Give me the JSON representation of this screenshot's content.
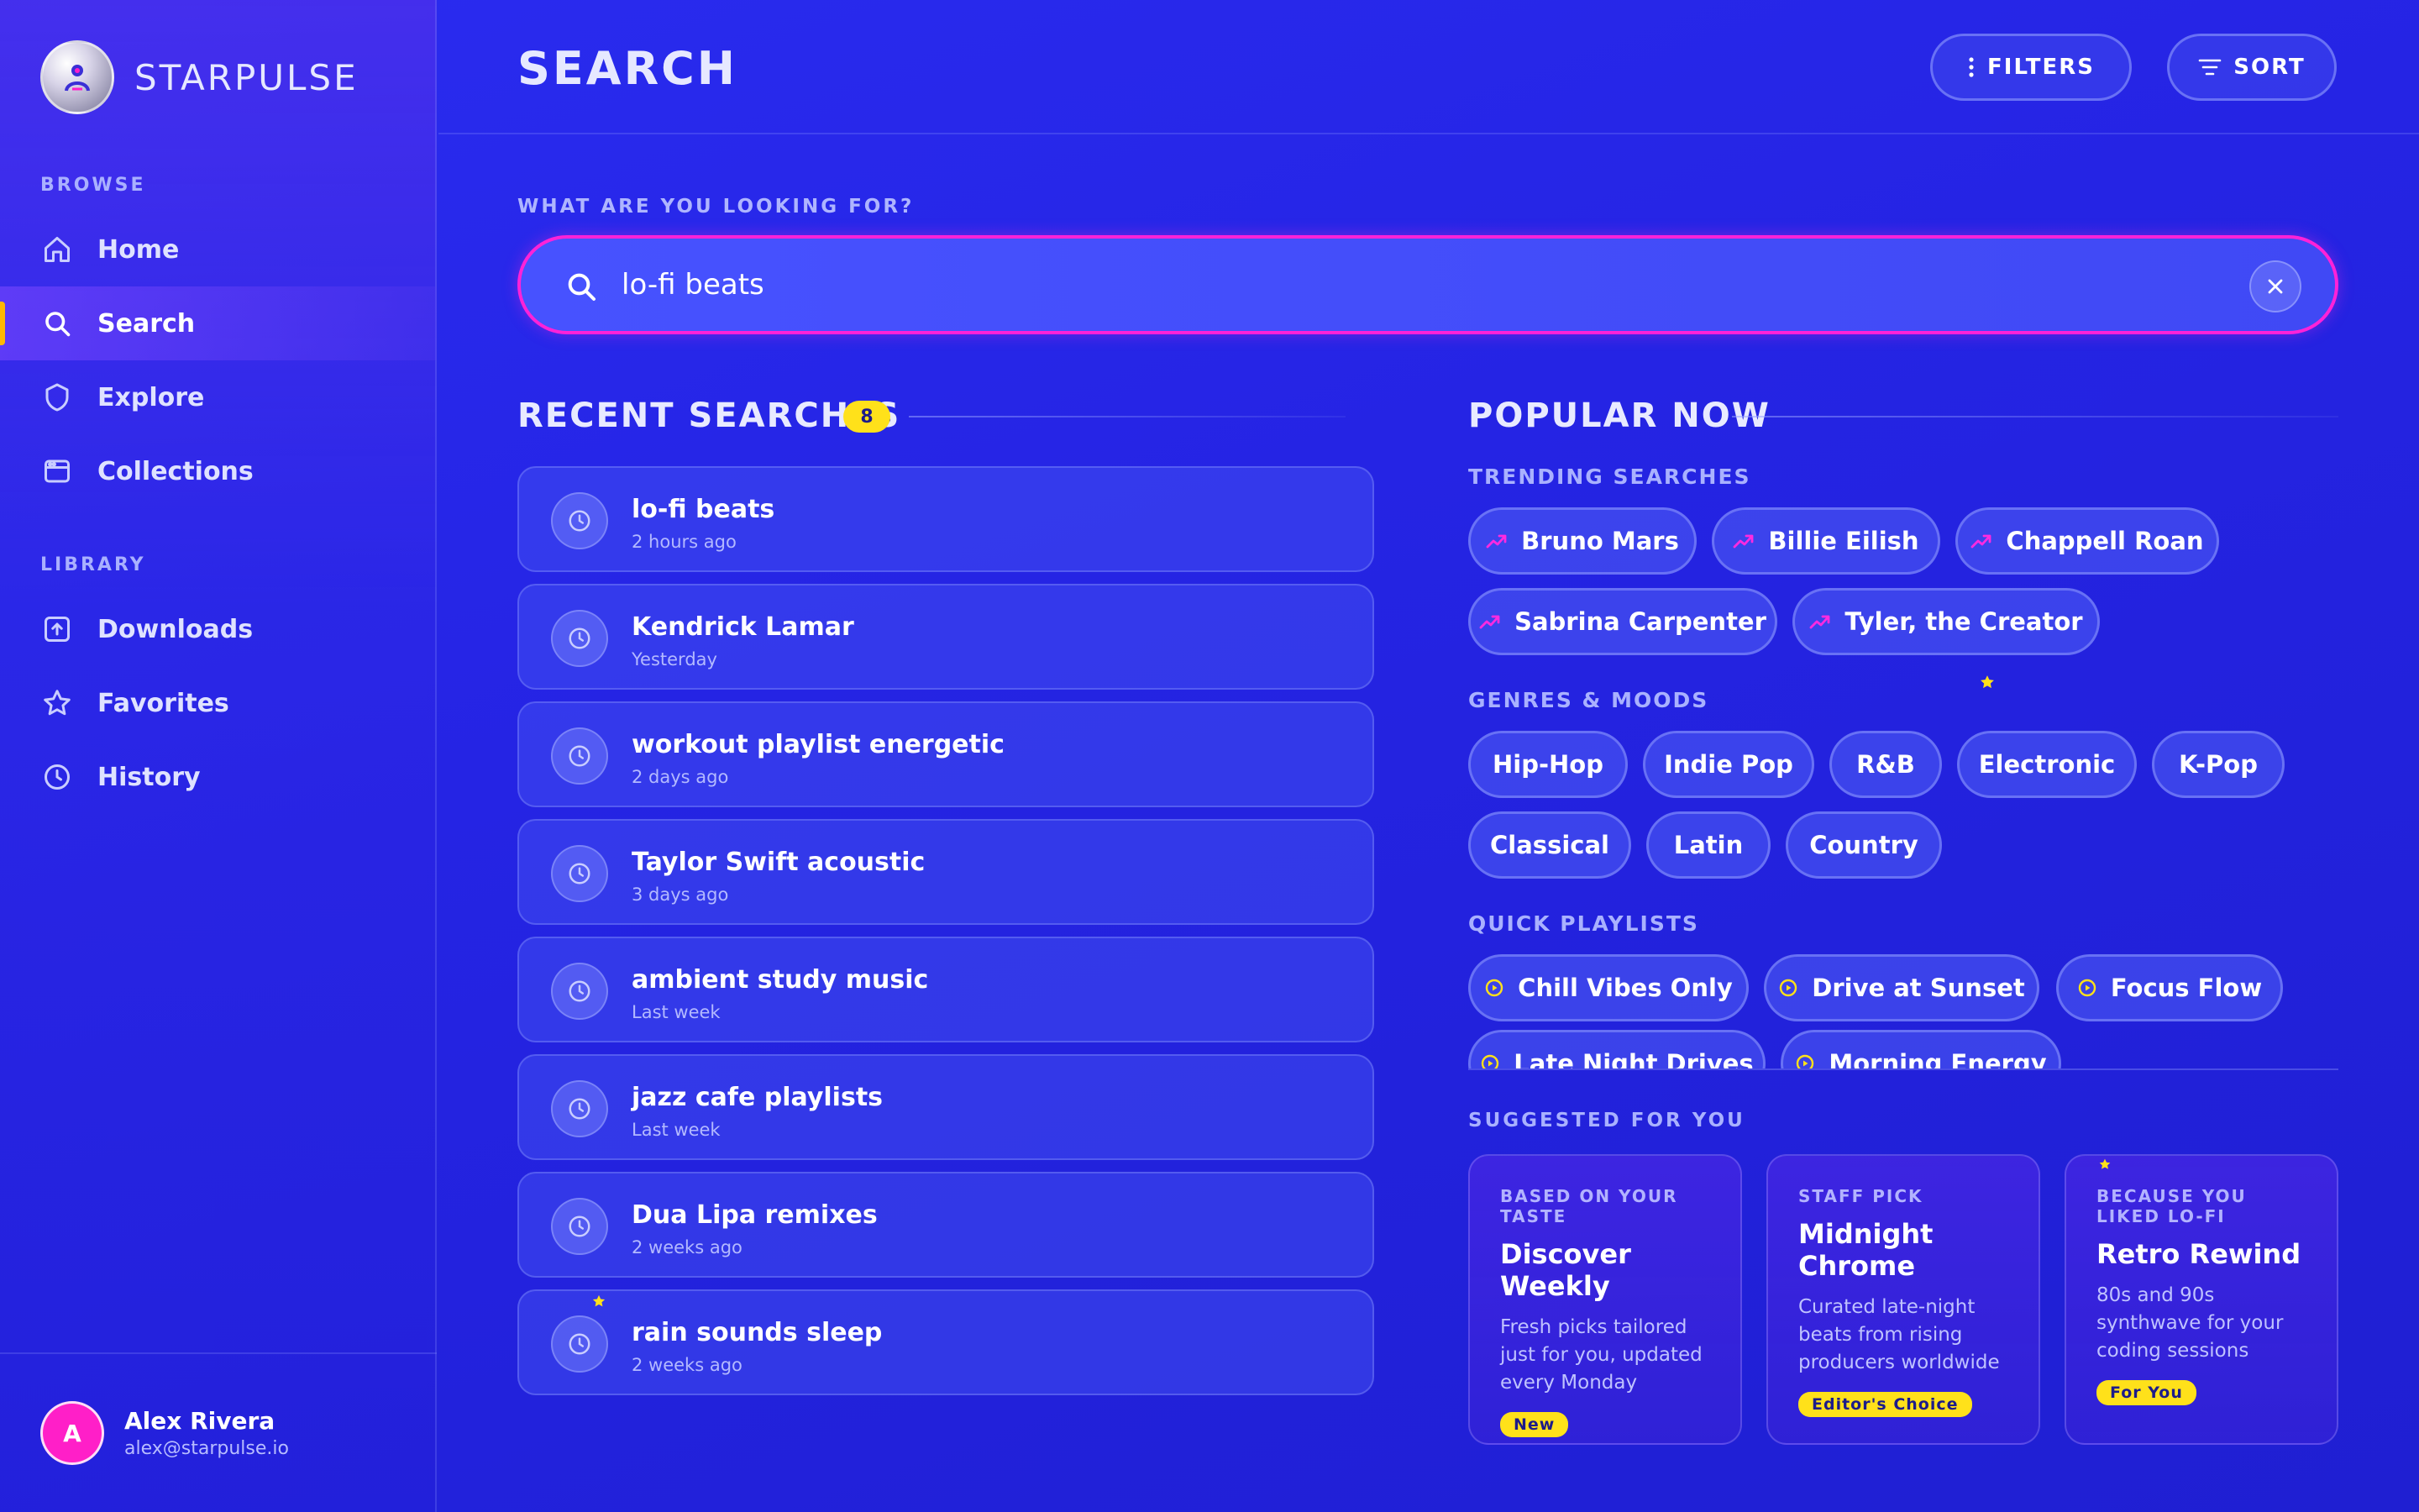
{
  "brand": {
    "name": "STARPULSE"
  },
  "sidebar": {
    "browse_label": "BROWSE",
    "library_label": "LIBRARY",
    "browse_items": [
      {
        "label": "Home",
        "icon": "home-icon"
      },
      {
        "label": "Search",
        "icon": "search-icon",
        "active": true
      },
      {
        "label": "Explore",
        "icon": "shield-icon"
      },
      {
        "label": "Collections",
        "icon": "collections-icon"
      }
    ],
    "library_items": [
      {
        "label": "Downloads",
        "icon": "download-icon"
      },
      {
        "label": "Favorites",
        "icon": "star-icon"
      },
      {
        "label": "History",
        "icon": "clock-icon"
      }
    ],
    "user": {
      "initial": "A",
      "name": "Alex Rivera",
      "email": "alex@starpulse.io"
    }
  },
  "header": {
    "title": "SEARCH",
    "filters_label": "FILTERS",
    "sort_label": "SORT"
  },
  "search": {
    "label": "WHAT ARE YOU LOOKING FOR?",
    "value": "lo-fi beats"
  },
  "recent": {
    "title": "RECENT SEARCHES",
    "count": "8",
    "items": [
      {
        "title": "lo-fi beats",
        "time": "2 hours ago"
      },
      {
        "title": "Kendrick Lamar",
        "time": "Yesterday"
      },
      {
        "title": "workout playlist energetic",
        "time": "2 days ago"
      },
      {
        "title": "Taylor Swift acoustic",
        "time": "3 days ago"
      },
      {
        "title": "ambient study music",
        "time": "Last week"
      },
      {
        "title": "jazz cafe playlists",
        "time": "Last week"
      },
      {
        "title": "Dua Lipa remixes",
        "time": "2 weeks ago"
      },
      {
        "title": "rain sounds sleep",
        "time": "2 weeks ago"
      }
    ]
  },
  "popular": {
    "title": "POPULAR NOW",
    "trending_label": "TRENDING SEARCHES",
    "trending": [
      "Bruno Mars",
      "Billie Eilish",
      "Chappell Roan",
      "Sabrina Carpenter",
      "Tyler, the Creator"
    ],
    "genres_label": "GENRES & MOODS",
    "genres": [
      "Hip-Hop",
      "Indie Pop",
      "R&B",
      "Electronic",
      "K-Pop",
      "Classical",
      "Latin",
      "Country"
    ],
    "playlists_label": "QUICK PLAYLISTS",
    "playlists": [
      "Chill Vibes Only",
      "Drive at Sunset",
      "Focus Flow",
      "Late Night Drives",
      "Morning Energy"
    ]
  },
  "suggested": {
    "title": "SUGGESTED FOR YOU",
    "cards": [
      {
        "eyebrow": "BASED ON YOUR TASTE",
        "title": "Discover Weekly",
        "desc": "Fresh picks tailored just for you, updated every Monday",
        "badge": "New"
      },
      {
        "eyebrow": "STAFF PICK",
        "title": "Midnight Chrome",
        "desc": "Curated late-night beats from rising producers worldwide",
        "badge": "Editor's Choice"
      },
      {
        "eyebrow": "BECAUSE YOU LIKED LO-FI",
        "title": "Retro Rewind",
        "desc": "80s and 90s synthwave for your coding sessions",
        "badge": "For You"
      }
    ]
  },
  "colors": {
    "background": "#2524e4",
    "accent_pink": "#ff22d8",
    "accent_yellow": "#ffe11a",
    "active_indicator": "#ffb800"
  }
}
